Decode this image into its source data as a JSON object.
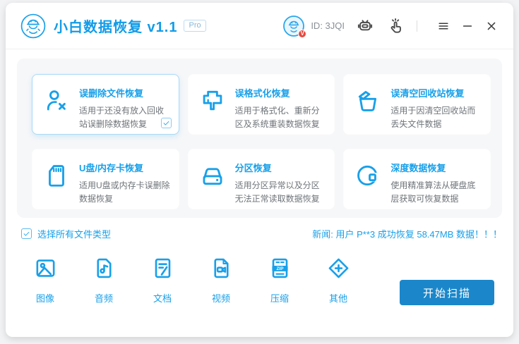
{
  "colors": {
    "accent": "#18a0e9",
    "title_blue": "#129ce8",
    "button_blue": "#1b87ca",
    "selected_card_border": "#a9d9f6",
    "secondary_text": "#6f7479",
    "muted_text": "#8a9097",
    "badge_red": "#e8483e"
  },
  "header": {
    "title": "小白数据恢复 v1.1",
    "pro_badge": "Pro",
    "user_id": "ID: 3JQI",
    "avatar_badge": "V",
    "icons": [
      "robot-mascot-logo",
      "avatar",
      "robot-service-icon",
      "hand-click-icon",
      "menu-icon",
      "minimize-icon",
      "close-icon"
    ]
  },
  "recovery_modes": [
    {
      "title": "误删除文件恢复",
      "desc": "适用于还没有放入回收站误删除数据恢复",
      "icon": "user-x-icon",
      "selected": true
    },
    {
      "title": "误格式化恢复",
      "desc": "适用于格式化、重新分区及系统重装数据恢复",
      "icon": "format-brush-icon",
      "selected": false
    },
    {
      "title": "误清空回收站恢复",
      "desc": "适用于因清空回收站而丢失文件数据",
      "icon": "recycle-bin-icon",
      "selected": false
    },
    {
      "title": "U盘/内存卡恢复",
      "desc": "适用U盘或内存卡误删除数据恢复",
      "icon": "sd-card-icon",
      "selected": false
    },
    {
      "title": "分区恢复",
      "desc": "适用分区异常以及分区无法正常读取数据恢复",
      "icon": "hard-drive-icon",
      "selected": false
    },
    {
      "title": "深度数据恢复",
      "desc": "使用精准算法从硬盘底层获取可恢复数据",
      "icon": "deep-scan-icon",
      "selected": false
    }
  ],
  "file_type_bar": {
    "select_all_label": "选择所有文件类型",
    "select_all_checked": true,
    "news": "新闻: 用户 P**3 成功恢复 58.47MB 数据！！！",
    "zip_label": "ZIP",
    "types": [
      {
        "label": "图像",
        "icon": "image-icon"
      },
      {
        "label": "音频",
        "icon": "audio-icon"
      },
      {
        "label": "文档",
        "icon": "document-icon"
      },
      {
        "label": "视频",
        "icon": "video-icon"
      },
      {
        "label": "压缩",
        "icon": "zip-icon"
      },
      {
        "label": "其他",
        "icon": "other-icon"
      }
    ]
  },
  "actions": {
    "scan_button": "开始扫描"
  }
}
